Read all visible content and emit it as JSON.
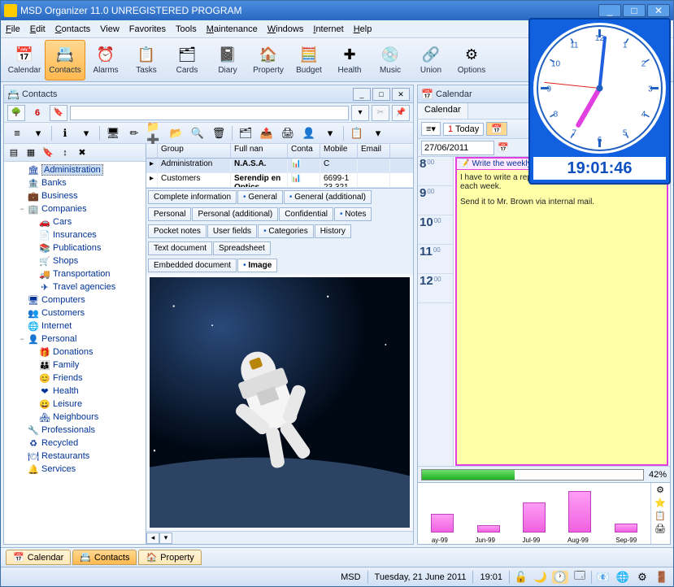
{
  "window": {
    "title": "MSD Organizer 11.0 UNREGISTERED PROGRAM"
  },
  "menus": [
    "File",
    "Edit",
    "Contacts",
    "View",
    "Favorites",
    "Tools",
    "Maintenance",
    "Windows",
    "Internet",
    "Help"
  ],
  "menus_u": [
    "F",
    "E",
    "C",
    "",
    "",
    "",
    "M",
    "W",
    "I",
    "H"
  ],
  "toolbar": [
    {
      "label": "Calendar",
      "icon": "📅"
    },
    {
      "label": "Contacts",
      "icon": "📇",
      "active": true
    },
    {
      "label": "Alarms",
      "icon": "⏰"
    },
    {
      "label": "Tasks",
      "icon": "📋"
    },
    {
      "label": "Cards",
      "icon": "🗂"
    },
    {
      "label": "Diary",
      "icon": "📓"
    },
    {
      "label": "Property",
      "icon": "🏠"
    },
    {
      "label": "Budget",
      "icon": "🧮"
    },
    {
      "label": "Health",
      "icon": "✚"
    },
    {
      "label": "Music",
      "icon": "💿"
    },
    {
      "label": "Union",
      "icon": "🔗"
    },
    {
      "label": "Options",
      "icon": "⚙"
    }
  ],
  "contacts_panel": {
    "title": "Contacts"
  },
  "filter": {
    "count": "6"
  },
  "tree": [
    {
      "label": "Administration",
      "icon": "🏛",
      "lvl": 1,
      "sel": true
    },
    {
      "label": "Banks",
      "icon": "🏦",
      "lvl": 1
    },
    {
      "label": "Business",
      "icon": "💼",
      "lvl": 1
    },
    {
      "label": "Companies",
      "icon": "🏢",
      "lvl": 1,
      "exp": "−"
    },
    {
      "label": "Cars",
      "icon": "🚗",
      "lvl": 2
    },
    {
      "label": "Insurances",
      "icon": "📄",
      "lvl": 2
    },
    {
      "label": "Publications",
      "icon": "📚",
      "lvl": 2
    },
    {
      "label": "Shops",
      "icon": "🛒",
      "lvl": 2
    },
    {
      "label": "Transportation",
      "icon": "🚚",
      "lvl": 2
    },
    {
      "label": "Travel agencies",
      "icon": "✈",
      "lvl": 2
    },
    {
      "label": "Computers",
      "icon": "🖥",
      "lvl": 1
    },
    {
      "label": "Customers",
      "icon": "👥",
      "lvl": 1
    },
    {
      "label": "Internet",
      "icon": "🌐",
      "lvl": 1
    },
    {
      "label": "Personal",
      "icon": "👤",
      "lvl": 1,
      "exp": "−"
    },
    {
      "label": "Donations",
      "icon": "🎁",
      "lvl": 2
    },
    {
      "label": "Family",
      "icon": "👪",
      "lvl": 2
    },
    {
      "label": "Friends",
      "icon": "😊",
      "lvl": 2
    },
    {
      "label": "Health",
      "icon": "❤",
      "lvl": 2
    },
    {
      "label": "Leisure",
      "icon": "😀",
      "lvl": 2
    },
    {
      "label": "Neighbours",
      "icon": "🏘",
      "lvl": 2
    },
    {
      "label": "Professionals",
      "icon": "🔧",
      "lvl": 1
    },
    {
      "label": "Recycled",
      "icon": "♻",
      "lvl": 1
    },
    {
      "label": "Restaurants",
      "icon": "🍽",
      "lvl": 1
    },
    {
      "label": "Services",
      "icon": "🔔",
      "lvl": 1
    }
  ],
  "grid": {
    "cols": [
      "Group",
      "Full nan",
      "Conta",
      "Mobile",
      "Email"
    ],
    "rows": [
      {
        "c": [
          "Administration",
          "N.A.S.A.",
          "📊",
          "C",
          ""
        ]
      },
      {
        "c": [
          "Customers",
          "Serendip en Optics",
          "📊",
          "6699-1 23 321",
          ""
        ]
      }
    ]
  },
  "tabs1": [
    "Complete information",
    "General",
    "General (additional)"
  ],
  "tabs1_dot": [
    false,
    true,
    true
  ],
  "tabs2": [
    "Personal",
    "Personal (additional)",
    "Confidential",
    "Notes"
  ],
  "tabs2_dot": [
    false,
    false,
    false,
    true
  ],
  "tabs3": [
    "Pocket notes",
    "User fields",
    "Categories",
    "History"
  ],
  "tabs3_dot": [
    false,
    false,
    true,
    false
  ],
  "tabs4": [
    "Text document",
    "Spreadsheet"
  ],
  "tabs5": [
    "Embedded document",
    "Image"
  ],
  "tabs5_active": 1,
  "calendar_panel": {
    "title": "Calendar",
    "tab": "Calendar",
    "today": "Today",
    "date": "27/06/2011"
  },
  "hours": [
    "8",
    "9",
    "10",
    "11",
    "12"
  ],
  "event": {
    "title": "Write the weekly report",
    "line1": "I have to write a report about the tasks I have completed each week.",
    "line2": "Send it to Mr. Brown via internal mail."
  },
  "progress": {
    "pct": "42%"
  },
  "clock": {
    "time": "19:01:46"
  },
  "bottom_tabs": [
    {
      "label": "Calendar",
      "icon": "📅"
    },
    {
      "label": "Contacts",
      "icon": "📇",
      "active": true
    },
    {
      "label": "Property",
      "icon": "🏠"
    }
  ],
  "status": {
    "brand": "MSD",
    "date": "Tuesday, 21 June 2011",
    "time": "19:01"
  },
  "chart_data": {
    "type": "bar",
    "categories": [
      "ay-99",
      "Jun-99",
      "Jul-99",
      "Aug-99",
      "Sep-99"
    ],
    "values": [
      25,
      10,
      40,
      55,
      12
    ],
    "ylim": [
      0,
      60
    ]
  }
}
